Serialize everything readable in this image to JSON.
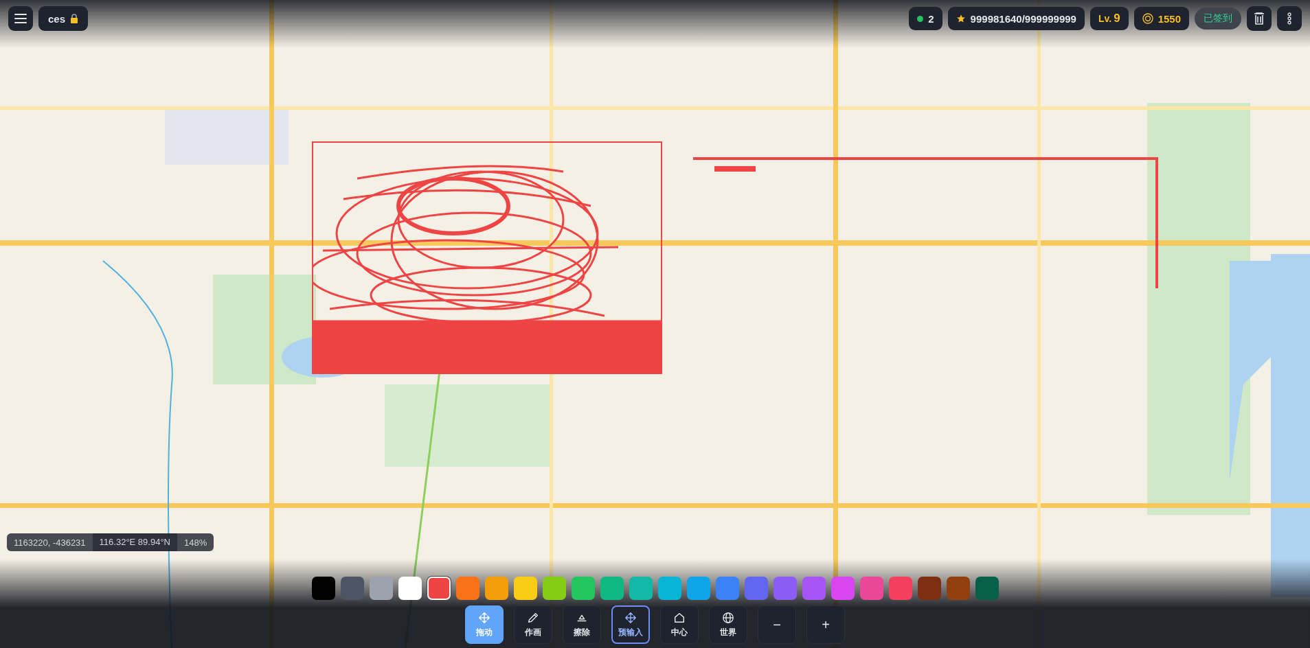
{
  "top_bar": {
    "user": {
      "name": "ces",
      "locked": true
    },
    "online": {
      "count": "2"
    },
    "pixels": {
      "value": "999981640/999999999"
    },
    "level": {
      "label": "Lv.",
      "value": "9"
    },
    "coins": {
      "value": "1550"
    },
    "checkin": {
      "label": "已签到",
      "done": true
    }
  },
  "status": {
    "coords": "1163220, -436231",
    "lonlat": "116.32°E 89.94°N",
    "zoom": "148%"
  },
  "palette": [
    {
      "color": "#000000",
      "selected": false
    },
    {
      "color": "#4b5563",
      "selected": false
    },
    {
      "color": "#9ca3af",
      "selected": false
    },
    {
      "color": "#ffffff",
      "selected": false
    },
    {
      "color": "#ef4444",
      "selected": true
    },
    {
      "color": "#f97316",
      "selected": false
    },
    {
      "color": "#f59e0b",
      "selected": false
    },
    {
      "color": "#facc15",
      "selected": false
    },
    {
      "color": "#84cc16",
      "selected": false
    },
    {
      "color": "#22c55e",
      "selected": false
    },
    {
      "color": "#10b981",
      "selected": false
    },
    {
      "color": "#14b8a6",
      "selected": false
    },
    {
      "color": "#06b6d4",
      "selected": false
    },
    {
      "color": "#0ea5e9",
      "selected": false
    },
    {
      "color": "#3b82f6",
      "selected": false
    },
    {
      "color": "#6366f1",
      "selected": false
    },
    {
      "color": "#8b5cf6",
      "selected": false
    },
    {
      "color": "#a855f7",
      "selected": false
    },
    {
      "color": "#d946ef",
      "selected": false
    },
    {
      "color": "#ec4899",
      "selected": false
    },
    {
      "color": "#f43f5e",
      "selected": false
    },
    {
      "color": "#7c2d12",
      "selected": false
    },
    {
      "color": "#92400e",
      "selected": false
    },
    {
      "color": "#065f46",
      "selected": false
    }
  ],
  "tools": [
    {
      "kind": "move",
      "label": "拖动",
      "selected": true,
      "toggled": false
    },
    {
      "kind": "draw",
      "label": "作画",
      "selected": false,
      "toggled": false
    },
    {
      "kind": "erase",
      "label": "擦除",
      "selected": false,
      "toggled": false
    },
    {
      "kind": "preinput",
      "label": "预输入",
      "selected": false,
      "toggled": true
    },
    {
      "kind": "center",
      "label": "中心",
      "selected": false,
      "toggled": false
    },
    {
      "kind": "world",
      "label": "世界",
      "selected": false,
      "toggled": false
    },
    {
      "kind": "zoom-out",
      "label": "−",
      "selected": false,
      "toggled": false
    },
    {
      "kind": "zoom-in",
      "label": "+",
      "selected": false,
      "toggled": false
    }
  ]
}
